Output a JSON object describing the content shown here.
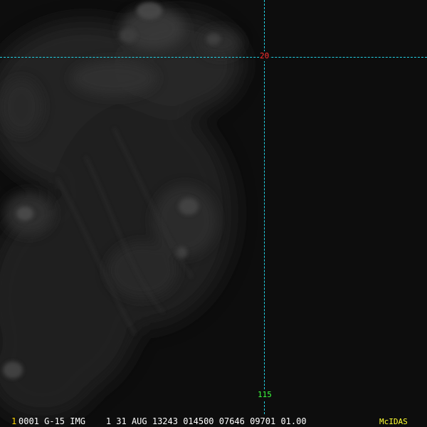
{
  "image": {
    "grid_color": "#22d3e6",
    "background_color": "#0d0d0d",
    "latitude_label": "20",
    "longitude_label": "115",
    "latitude_label_color": "#ff3030",
    "longitude_label_color": "#3cff3c"
  },
  "status_bar": {
    "frame_number": "1",
    "header": "0001 G-15 IMG    1 31 AUG 13243 014500 07646 09701 01.00",
    "brand": "McIDAS",
    "frame_number_color": "#ffd400",
    "brand_color": "#ffff33"
  }
}
